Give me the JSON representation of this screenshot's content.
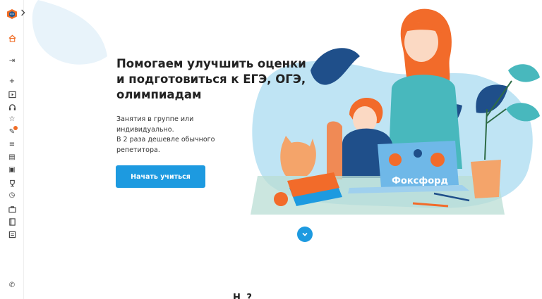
{
  "sidebar": {
    "logo": "foxford-logo",
    "expand_icon": "chevron-right-icon",
    "items": [
      {
        "icon": "home-icon",
        "glyph": "⌂"
      },
      {
        "icon": "login-icon",
        "glyph": "⇥"
      },
      {
        "icon": "plus-icon",
        "glyph": "+"
      },
      {
        "icon": "play-icon",
        "glyph": "▸"
      },
      {
        "icon": "headphones-icon",
        "glyph": "∩"
      },
      {
        "icon": "star-icon",
        "glyph": "☆"
      },
      {
        "icon": "tools-icon",
        "glyph": "✎"
      },
      {
        "icon": "list-icon",
        "glyph": "≡"
      },
      {
        "icon": "document-icon",
        "glyph": "▤"
      },
      {
        "icon": "bus-icon",
        "glyph": "▣"
      },
      {
        "icon": "trophy-icon",
        "glyph": "♖"
      },
      {
        "icon": "clock-icon",
        "glyph": "◷"
      },
      {
        "icon": "briefcase-icon",
        "glyph": "▦"
      },
      {
        "icon": "book-icon",
        "glyph": "▥"
      },
      {
        "icon": "notes-icon",
        "glyph": "☰"
      }
    ],
    "footer_icon": "phone-icon",
    "footer_glyph": "✆",
    "accent": "#f06d26"
  },
  "hero": {
    "title": "Помогаем улучшить оценки и подготовиться к ЕГЭ, ОГЭ, олимпиадам",
    "subtitle_line1": "Занятия в группе или индивидуально.",
    "subtitle_line2": "В 2 раза дешевле обычного репетитора.",
    "cta_label": "Начать учиться",
    "laptop_brand": "Фоксфорд"
  },
  "scroll_icon": "chevron-down-icon",
  "section_peek": "Н              ?",
  "colors": {
    "primary": "#1d9ae0",
    "accent": "#f06d26",
    "teal": "#48b8bd"
  }
}
